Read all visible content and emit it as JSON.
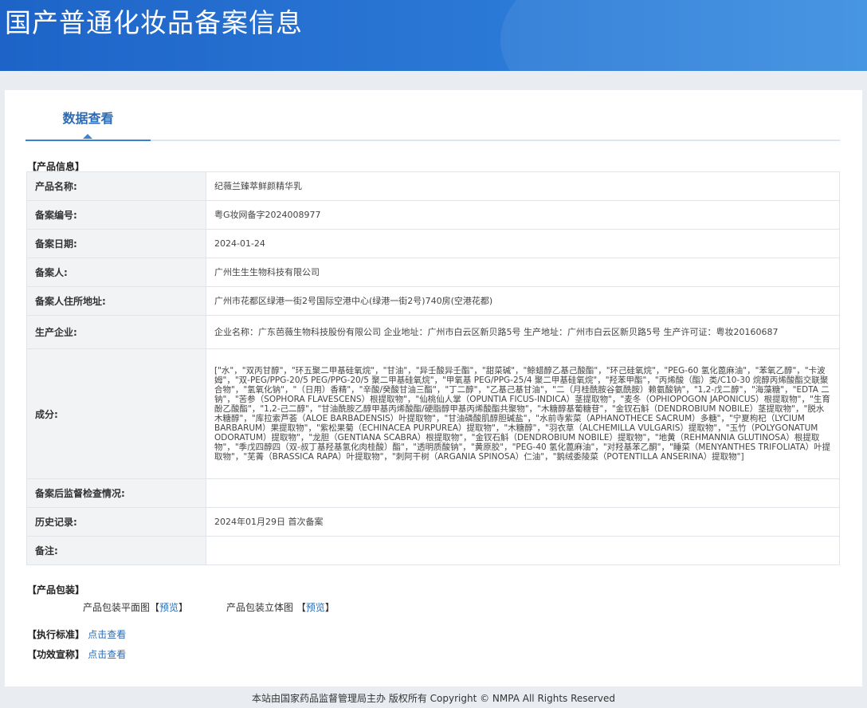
{
  "header": {
    "title": "国产普通化妆品备案信息"
  },
  "tabs": [
    {
      "label": "数据查看"
    }
  ],
  "product_info": {
    "section_label": "【产品信息】",
    "rows": [
      {
        "label": "产品名称:",
        "value": "纪薇兰臻萃鲜颜精华乳"
      },
      {
        "label": "备案编号:",
        "value": "粤G妆网备字2024008977"
      },
      {
        "label": "备案日期:",
        "value": "2024-01-24"
      },
      {
        "label": "备案人:",
        "value": "广州生生生物科技有限公司"
      },
      {
        "label": "备案人住所地址:",
        "value": "广州市花都区绿港一街2号国际空港中心(绿港一街2号)740房(空港花都)"
      },
      {
        "label": "生产企业:",
        "value": "企业名称：广东芭薇生物科技股份有限公司 企业地址：广州市白云区新贝路5号 生产地址：广州市白云区新贝路5号 生产许可证：粤妆20160687"
      },
      {
        "label": "成分:",
        "value": "[\"水\"，\"双丙甘醇\"，\"环五聚二甲基硅氧烷\"，\"甘油\"，\"异壬酸异壬酯\"，\"甜菜碱\"，\"鲸蜡醇乙基己酸酯\"，\"环己硅氧烷\"，\"PEG-60 氢化蓖麻油\"，\"苯氧乙醇\"，\"卡波姆\"，\"双-PEG/PPG-20/5 PEG/PPG-20/5 聚二甲基硅氧烷\"，\"甲氧基 PEG/PPG-25/4 聚二甲基硅氧烷\"，\"羟苯甲酯\"，\"丙烯酸（酯）类/C10-30 烷醇丙烯酸酯交联聚合物\"，\"氢氧化钠\"，\"（日用）香精\"，\"辛酸/癸酸甘油三酯\"，\"丁二醇\"，\"乙基己基甘油\"，\"二（月桂酰胺谷氨酰胺）赖氨酸钠\"，\"1,2-戊二醇\"，\"海藻糖\"，\"EDTA 二钠\"，\"苦参（SOPHORA FLAVESCENS）根提取物\"，\"仙桃仙人掌（OPUNTIA FICUS-INDICA）茎提取物\"，\"麦冬（OPHIOPOGON JAPONICUS）根提取物\"，\"生育酚乙酸酯\"，\"1,2-己二醇\"，\"甘油酰胺乙醇甲基丙烯酸酯/硬脂醇甲基丙烯酸酯共聚物\"，\"木糖醇基葡糖苷\"，\"金钗石斛（DENDROBIUM NOBILE）茎提取物\"，\"脱水木糖醇\"，\"库拉索芦荟（ALOE BARBADENSIS）叶提取物\"，\"甘油磷酸肌醇胆碱盐\"，\"水前寺紫菜（APHANOTHECE SACRUM）多糖\"，\"宁夏枸杞（LYCIUM BARBARUM）果提取物\"，\"紫松果菊（ECHINACEA PURPUREA）提取物\"，\"木糖醇\"，\"羽衣草（ALCHEMILLA VULGARIS）提取物\"，\"玉竹（POLYGONATUM ODORATUM）提取物\"，\"龙胆（GENTIANA SCABRA）根提取物\"，\"金钗石斛（DENDROBIUM NOBILE）提取物\"，\"地黄（REHMANNIA GLUTINOSA）根提取物\"，\"季戊四醇四（双-叔丁基羟基氢化肉桂酸）酯\"，\"透明质酸钠\"，\"黄原胶\"，\"PEG-40 氢化蓖麻油\"，\"对羟基苯乙酮\"，\"睡菜（MENYANTHES TRIFOLIATA）叶提取物\"，\"芜菁（BRASSICA RAPA）叶提取物\"，\"刺阿干树（ARGANIA SPINOSA）仁油\"，\"鹅绒委陵菜（POTENTILLA ANSERINA）提取物\"]"
      },
      {
        "label": "备案后监督检查情况:",
        "value": ""
      },
      {
        "label": "历史记录:",
        "value": "2024年01月29日 首次备案"
      },
      {
        "label": "备注:",
        "value": ""
      }
    ]
  },
  "packaging": {
    "section_label": "【产品包装】",
    "flat_label": "产品包装平面图",
    "flat_link": "预览",
    "solid_label": "产品包装立体图",
    "solid_link": "预览",
    "bracket_open": "【",
    "bracket_close": "】"
  },
  "standard": {
    "label": "【执行标准】",
    "link": "点击查看"
  },
  "efficacy": {
    "label": "【功效宣称】",
    "link": "点击查看"
  },
  "footer": {
    "text": "本站由国家药品监督管理局主办 版权所有 Copyright © NMPA All Rights Reserved"
  }
}
